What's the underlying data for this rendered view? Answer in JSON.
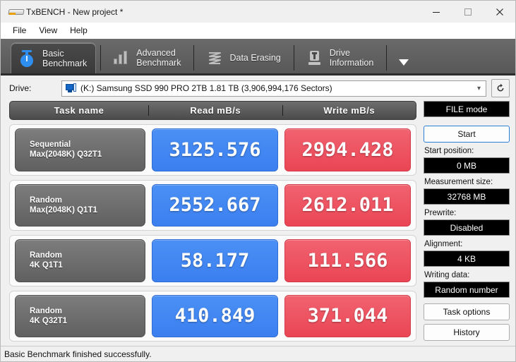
{
  "window": {
    "title": "TxBENCH - New project *",
    "app_icon": "drive-icon",
    "minimize": "minimize-icon",
    "maximize": "maximize-icon",
    "close": "close-icon"
  },
  "menu": {
    "items": [
      {
        "label": "File"
      },
      {
        "label": "View"
      },
      {
        "label": "Help"
      }
    ]
  },
  "tabs": {
    "overflow_icon": "chevron-down-icon",
    "items": [
      {
        "label": "Basic\nBenchmark",
        "icon": "stopwatch-icon",
        "active": true
      },
      {
        "label": "Advanced\nBenchmark",
        "icon": "bar-chart-icon",
        "active": false
      },
      {
        "label": "Data Erasing",
        "icon": "shredder-icon",
        "active": false
      },
      {
        "label": "Drive\nInformation",
        "icon": "drive-info-icon",
        "active": false
      }
    ]
  },
  "drive": {
    "label": "Drive:",
    "value": "(K:) Samsung SSD 990 PRO 2TB  1.81 TB (3,906,994,176 Sectors)",
    "icon": "computer-drive-icon",
    "caret": "chevron-down-icon",
    "refresh_icon": "refresh-icon"
  },
  "results": {
    "columns": [
      "Task name",
      "Read mB/s",
      "Write mB/s"
    ],
    "rows": [
      {
        "name_line1": "Sequential",
        "name_line2": "Max(2048K) Q32T1",
        "read": "3125.576",
        "write": "2994.428"
      },
      {
        "name_line1": "Random",
        "name_line2": "Max(2048K) Q1T1",
        "read": "2552.667",
        "write": "2612.011"
      },
      {
        "name_line1": "Random",
        "name_line2": "4K Q1T1",
        "read": "58.177",
        "write": "111.566"
      },
      {
        "name_line1": "Random",
        "name_line2": "4K Q32T1",
        "read": "410.849",
        "write": "371.044"
      }
    ]
  },
  "sidepanel": {
    "mode": "FILE mode",
    "start_button": "Start",
    "start_position_label": "Start position:",
    "start_position_value": "0 MB",
    "measurement_size_label": "Measurement size:",
    "measurement_size_value": "32768 MB",
    "prewrite_label": "Prewrite:",
    "prewrite_value": "Disabled",
    "alignment_label": "Alignment:",
    "alignment_value": "4 KB",
    "writing_data_label": "Writing data:",
    "writing_data_value": "Random number",
    "task_options_button": "Task options",
    "history_button": "History"
  },
  "status": {
    "text": "Basic Benchmark finished successfully."
  },
  "colors": {
    "read": "#3b7ff0",
    "write": "#ea4554",
    "accent": "#2f8ff0",
    "tabstrip": "#5f5f5f"
  }
}
